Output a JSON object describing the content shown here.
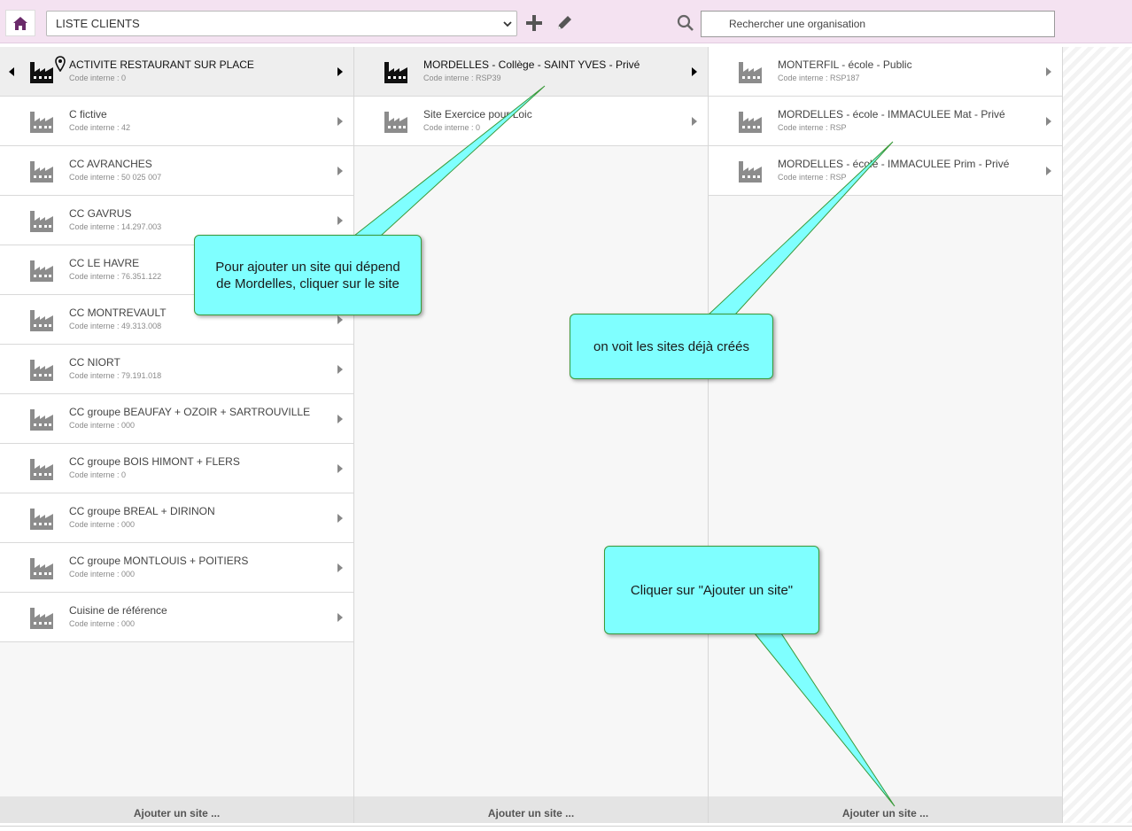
{
  "toolbar": {
    "home_icon": "home-icon",
    "list_select_value": "LISTE CLIENTS",
    "add_icon": "plus-icon",
    "edit_icon": "pencil-icon",
    "search_icon": "magnifier-icon",
    "search_placeholder": "Rechercher une organisation",
    "accent_color": "#6a2a6a"
  },
  "columns": [
    {
      "items": [
        {
          "name": "ACTIVITE RESTAURANT SUR PLACE",
          "code": "Code interne : 0",
          "selected": true
        },
        {
          "name": "C fictive",
          "code": "Code interne : 42"
        },
        {
          "name": "CC AVRANCHES",
          "code": "Code interne : 50 025 007"
        },
        {
          "name": "CC GAVRUS",
          "code": "Code interne : 14.297.003"
        },
        {
          "name": "CC LE HAVRE",
          "code": "Code interne : 76.351.122"
        },
        {
          "name": "CC MONTREVAULT",
          "code": "Code interne : 49.313.008"
        },
        {
          "name": "CC NIORT",
          "code": "Code interne : 79.191.018"
        },
        {
          "name": "CC groupe BEAUFAY + OZOIR + SARTROUVILLE",
          "code": "Code interne : 000"
        },
        {
          "name": "CC groupe BOIS HIMONT + FLERS",
          "code": "Code interne : 0"
        },
        {
          "name": "CC groupe BREAL + DIRINON",
          "code": "Code interne : 000"
        },
        {
          "name": "CC groupe MONTLOUIS + POITIERS",
          "code": "Code interne : 000"
        },
        {
          "name": "Cuisine de référence",
          "code": "Code interne : 000"
        }
      ],
      "add_label": "Ajouter un site ..."
    },
    {
      "items": [
        {
          "name": "MORDELLES - Collège - SAINT YVES - Privé",
          "code": "Code interne : RSP39",
          "selected": true
        },
        {
          "name": "Site Exercice pour Loic",
          "code": "Code interne : 0"
        }
      ],
      "add_label": "Ajouter un site ..."
    },
    {
      "items": [
        {
          "name": "MONTERFIL - école - Public",
          "code": "Code interne : RSP187"
        },
        {
          "name": "MORDELLES - école - IMMACULEE Mat - Privé",
          "code": "Code interne : RSP"
        },
        {
          "name": "MORDELLES - école - IMMACULEE Prim - Privé",
          "code": "Code interne : RSP"
        }
      ],
      "add_label": "Ajouter un site ..."
    }
  ],
  "callouts": {
    "add_site_dependent": "Pour ajouter un site qui dépend de Mordelles, cliquer sur le site",
    "existing_sites": "on voit les sites déjà créés",
    "click_add_site": "Cliquer sur \"Ajouter un site\""
  }
}
